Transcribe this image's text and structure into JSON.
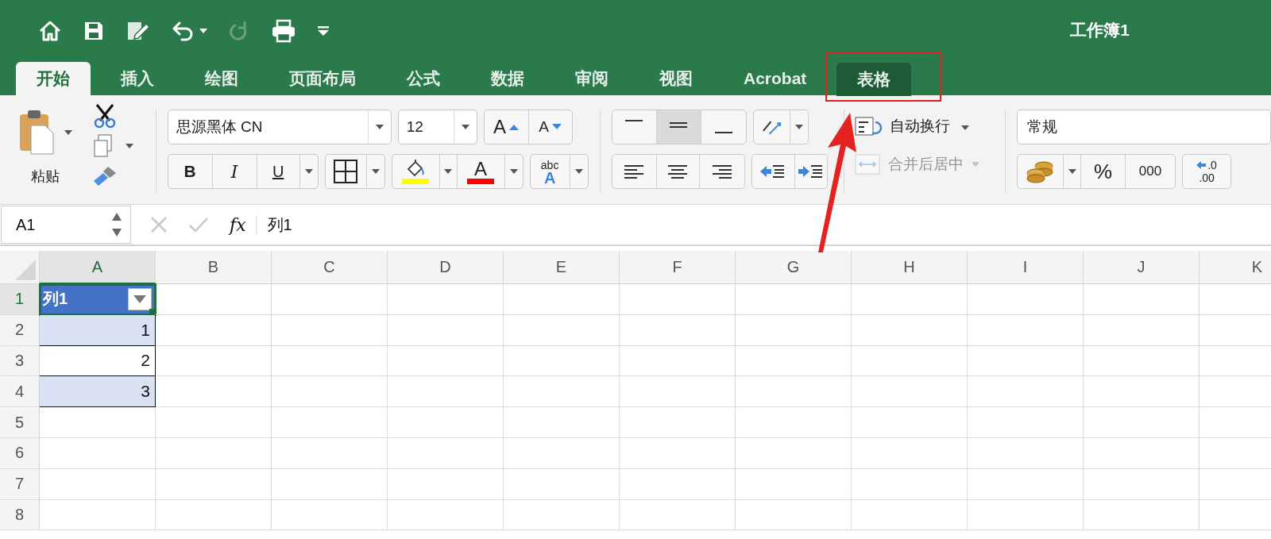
{
  "window": {
    "title": "工作簿1"
  },
  "quick_access": [
    {
      "kind": "home",
      "disabled": false
    },
    {
      "kind": "save",
      "disabled": false
    },
    {
      "kind": "edit",
      "disabled": false
    },
    {
      "kind": "undo",
      "disabled": false
    },
    {
      "kind": "redo",
      "disabled": true
    },
    {
      "kind": "print",
      "disabled": false
    },
    {
      "kind": "customize",
      "disabled": false
    }
  ],
  "tabs": [
    {
      "label": "开始",
      "selected": true,
      "highlighted": false
    },
    {
      "label": "插入",
      "selected": false,
      "highlighted": false
    },
    {
      "label": "绘图",
      "selected": false,
      "highlighted": false
    },
    {
      "label": "页面布局",
      "selected": false,
      "highlighted": false
    },
    {
      "label": "公式",
      "selected": false,
      "highlighted": false
    },
    {
      "label": "数据",
      "selected": false,
      "highlighted": false
    },
    {
      "label": "审阅",
      "selected": false,
      "highlighted": false
    },
    {
      "label": "视图",
      "selected": false,
      "highlighted": false
    },
    {
      "label": "Acrobat",
      "selected": false,
      "highlighted": false
    },
    {
      "label": "表格",
      "selected": false,
      "highlighted": true
    }
  ],
  "ribbon": {
    "paste_label": "粘贴",
    "font_name": "思源黑体 CN",
    "font_size": "12",
    "grow_font": "A",
    "shrink_font": "A",
    "bold": "B",
    "italic": "I",
    "underline": "U",
    "font_color_label": "A",
    "style_labels": [
      "abc",
      "A"
    ],
    "vertical_align": [
      {
        "kind": "top",
        "selected": false
      },
      {
        "kind": "middle",
        "selected": true
      },
      {
        "kind": "bottom",
        "selected": false
      }
    ],
    "wrap_text": "自动换行",
    "merge_center": {
      "label": "合并后居中",
      "disabled": true
    },
    "number_format": "常规",
    "percent": "%",
    "thousands": "000",
    "decimal_labels": [
      ".0",
      ".00"
    ]
  },
  "formula_bar": {
    "name_box": "A1",
    "fx": "fx",
    "content": "列1"
  },
  "sheet": {
    "columns": [
      {
        "label": "A",
        "selected": true
      },
      {
        "label": "B",
        "selected": false
      },
      {
        "label": "C",
        "selected": false
      },
      {
        "label": "D",
        "selected": false
      },
      {
        "label": "E",
        "selected": false
      },
      {
        "label": "F",
        "selected": false
      },
      {
        "label": "G",
        "selected": false
      },
      {
        "label": "H",
        "selected": false
      },
      {
        "label": "I",
        "selected": false
      },
      {
        "label": "J",
        "selected": false
      },
      {
        "label": "K",
        "selected": false
      }
    ],
    "rows": [
      {
        "label": "1",
        "selected": true,
        "cells": [
          {
            "value": "列1",
            "kind": "header",
            "selected": true
          }
        ]
      },
      {
        "label": "2",
        "selected": false,
        "cells": [
          {
            "value": "1",
            "kind": "number",
            "banded": true,
            "selected": false
          }
        ]
      },
      {
        "label": "3",
        "selected": false,
        "cells": [
          {
            "value": "2",
            "kind": "number",
            "banded": false,
            "selected": false
          }
        ]
      },
      {
        "label": "4",
        "selected": false,
        "cells": [
          {
            "value": "3",
            "kind": "number",
            "banded": true,
            "selected": false
          }
        ]
      },
      {
        "label": "5",
        "selected": false
      },
      {
        "label": "6",
        "selected": false
      },
      {
        "label": "7",
        "selected": false
      },
      {
        "label": "8",
        "selected": false
      }
    ]
  }
}
